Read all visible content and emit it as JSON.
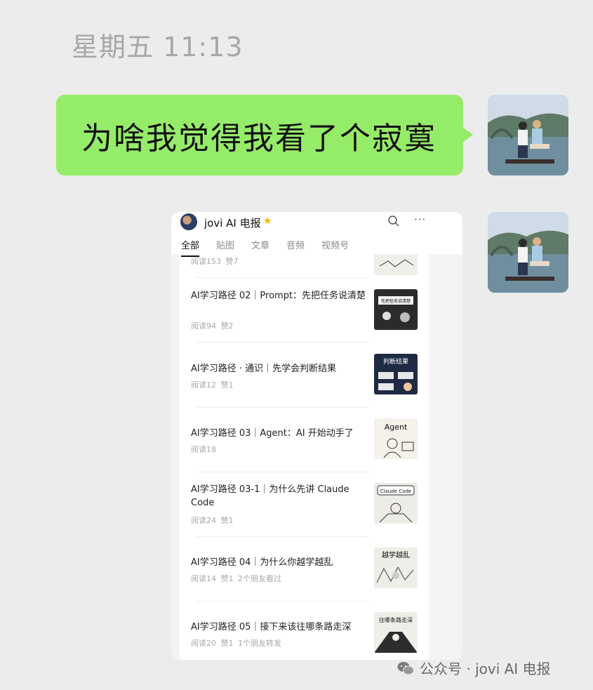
{
  "chat": {
    "timestamp": "星期五 11:13",
    "message_text": "为啥我觉得我看了个寂寞"
  },
  "shared_screenshot": {
    "account_name": "jovi AI 电报",
    "tabs": [
      "全部",
      "贴图",
      "文章",
      "音频",
      "视频号"
    ],
    "active_tab": "全部",
    "top_partial_meta": "阅读153  赞7",
    "articles": [
      {
        "title": "AI学习路径 02｜Prompt：先把任务说清楚",
        "meta": "阅读94  赞2",
        "thumb_text": "先把任务说清楚"
      },
      {
        "title": "AI学习路径 · 通识｜先学会判断结果",
        "meta": "阅读12  赞1",
        "thumb_text": "判断结果"
      },
      {
        "title": "AI学习路径 03｜Agent：AI 开始动手了",
        "meta": "阅读18",
        "thumb_text": "Agent"
      },
      {
        "title": "AI学习路径 03-1｜为什么先讲 Claude Code",
        "meta": "阅读24  赞1",
        "thumb_text": "Claude Code"
      },
      {
        "title": "AI学习路径 04｜为什么你越学越乱",
        "meta": "阅读14  赞1  2个朋友看过",
        "thumb_text": "越学越乱"
      },
      {
        "title": "AI学习路径 05｜接下来该往哪条路走深",
        "meta": "阅读20  赞1  1个朋友转发",
        "thumb_text": "往哪条路走深"
      }
    ]
  },
  "watermark": "公众号 · jovi AI 电报",
  "colors": {
    "background": "#ececec",
    "bubble": "#95ec69",
    "timestamp": "#a7a7a7"
  }
}
